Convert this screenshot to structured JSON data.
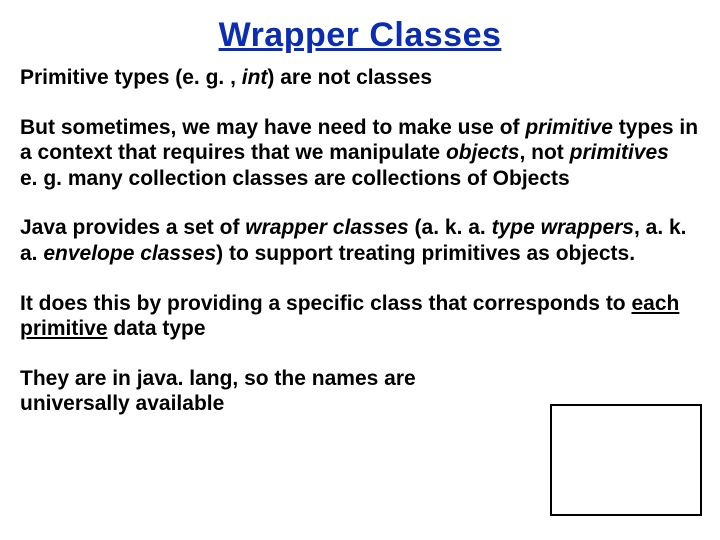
{
  "title": "Wrapper Classes",
  "p1": {
    "a": "Primitive types (e. g. , ",
    "b": "int",
    "c": ") are not classes"
  },
  "p2": {
    "a": "But sometimes, we may have need to make use of ",
    "b": "primitive",
    "c": " types in a context that requires that we manipulate ",
    "d": "objects",
    "e": ", not ",
    "f": "primitives",
    "g": "e. g. many collection classes are collections of Objects"
  },
  "p3": {
    "a": "Java provides a set of ",
    "b": "wrapper classes",
    "c": "  (a. k. a. ",
    "d": "type wrappers",
    "e": ", a. k. a. ",
    "f": "envelope classes",
    "g": ") to support treating primitives as objects."
  },
  "p4": {
    "a": "It does this by providing a specific class that corresponds to ",
    "b": "each primitive",
    "c": " data type"
  },
  "p5": {
    "a": "They are in java. lang, so the names are  universally available"
  }
}
